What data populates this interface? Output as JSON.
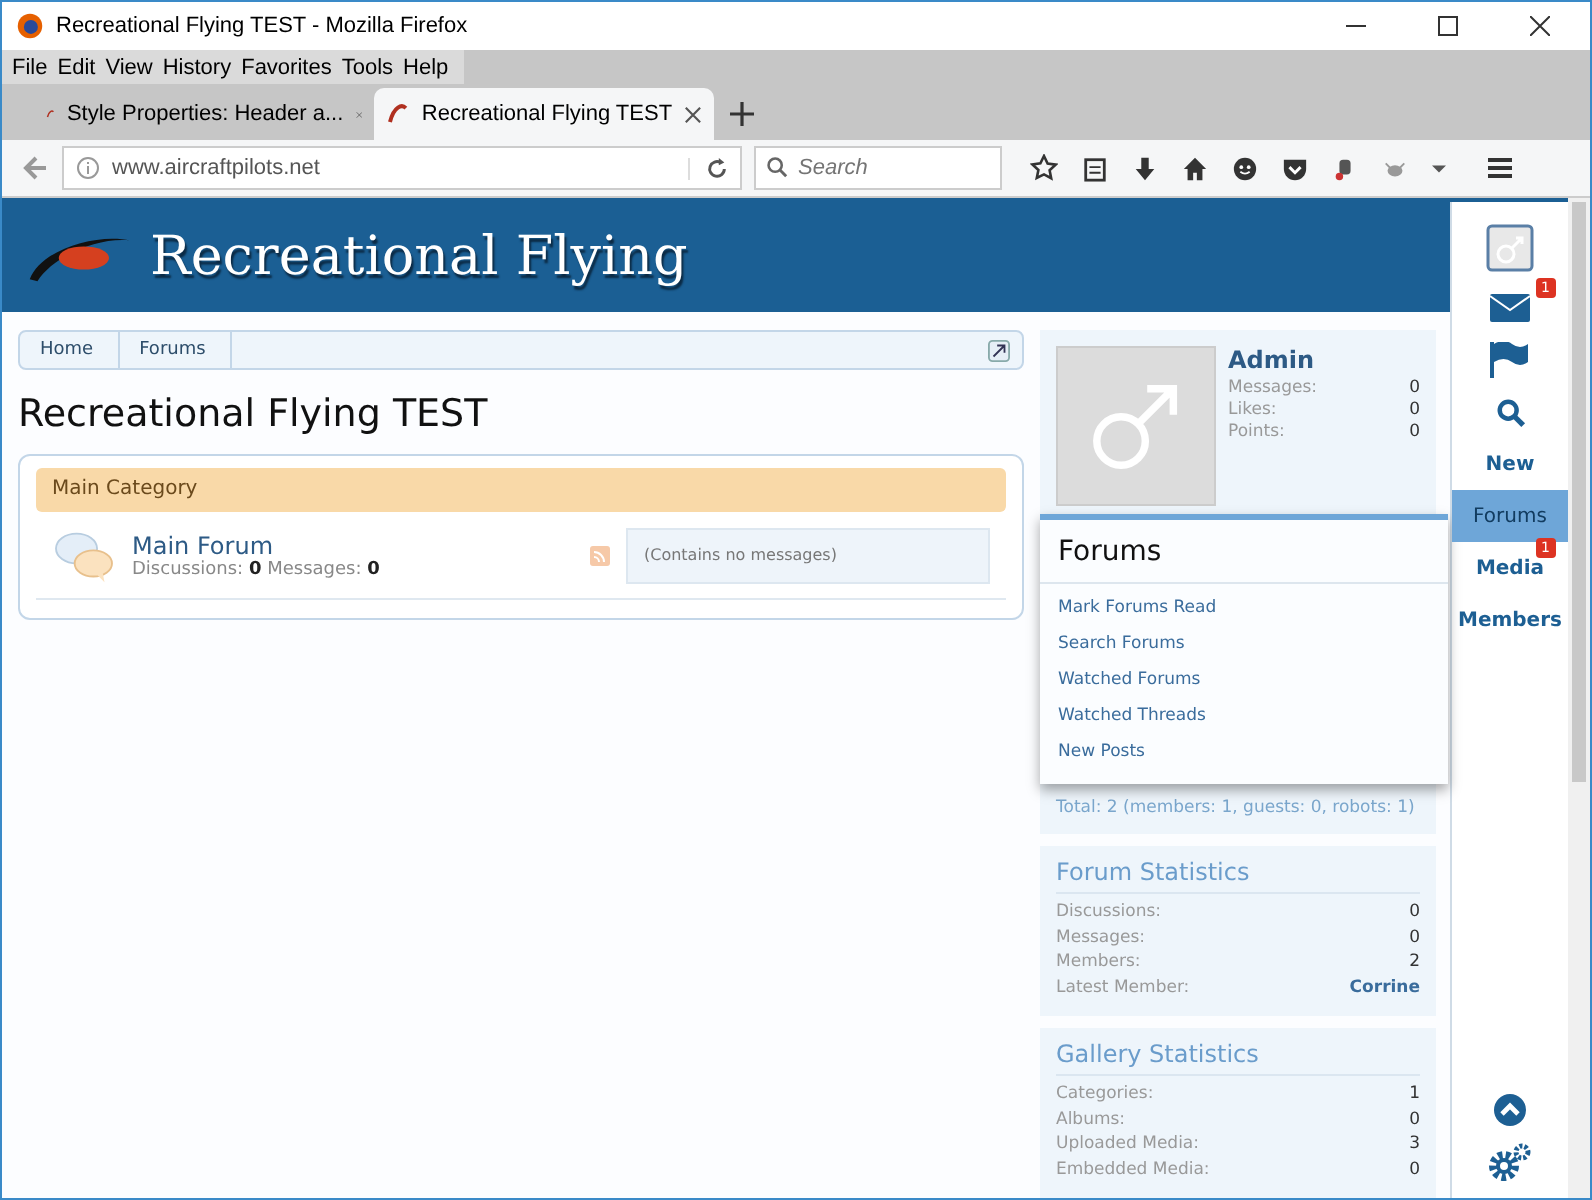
{
  "window": {
    "title": "Recreational Flying TEST - Mozilla Firefox"
  },
  "menu_bar": [
    "File",
    "Edit",
    "View",
    "History",
    "Favorites",
    "Tools",
    "Help"
  ],
  "tabs": [
    {
      "label": "Style Properties: Header a...",
      "selected": false
    },
    {
      "label": "Recreational Flying TEST",
      "selected": true
    }
  ],
  "address_bar": {
    "url": "www.aircraftpilots.net"
  },
  "search": {
    "placeholder": "Search"
  },
  "site": {
    "logo_text": "Recreational Flying"
  },
  "breadcrumbs": [
    "Home",
    "Forums"
  ],
  "page_title": "Recreational Flying TEST",
  "category": {
    "title": "Main Category",
    "forums": [
      {
        "name": "Main Forum",
        "stats": "Discussions: **0** Messages: **0**",
        "last_post": "(Contains no messages)"
      }
    ]
  },
  "user_panel": {
    "name": "Admin",
    "stats": [
      {
        "label": "Messages:",
        "value": "0"
      },
      {
        "label": "Likes:",
        "value": "0"
      },
      {
        "label": "Points:",
        "value": "0"
      }
    ]
  },
  "online": {
    "total": "Total: 2 (members: 1, guests: 0, robots: 1)"
  },
  "stat_panels": [
    {
      "title": "Forum Statistics",
      "rows": [
        {
          "label": "Discussions:",
          "value": "0",
          "link": false
        },
        {
          "label": "Messages:",
          "value": "0",
          "link": false
        },
        {
          "label": "Members:",
          "value": "2",
          "link": false
        },
        {
          "label": "Latest Member:",
          "value": "Corrine",
          "link": true
        }
      ]
    },
    {
      "title": "Gallery Statistics",
      "rows": [
        {
          "label": "Categories:",
          "value": "1",
          "link": false
        },
        {
          "label": "Albums:",
          "value": "0",
          "link": false
        },
        {
          "label": "Uploaded Media:",
          "value": "3",
          "link": false
        },
        {
          "label": "Embedded Media:",
          "value": "0",
          "link": false
        }
      ]
    }
  ],
  "side_nav": [
    {
      "kind": "avatar",
      "selected": false
    },
    {
      "kind": "mail",
      "badge": "1",
      "selected": false
    },
    {
      "kind": "flag",
      "selected": false
    },
    {
      "kind": "search",
      "selected": false
    },
    {
      "kind": "text",
      "label": "New",
      "selected": false
    },
    {
      "kind": "text",
      "label": "Forums",
      "selected": true
    },
    {
      "kind": "text",
      "label": "Media",
      "badge": "1",
      "selected": false
    },
    {
      "kind": "text",
      "label": "Members",
      "selected": false
    }
  ],
  "popup": {
    "title": "Forums",
    "items": [
      "Mark Forums Read",
      "Search Forums",
      "Watched Forums",
      "Watched Threads",
      "New Posts"
    ]
  }
}
